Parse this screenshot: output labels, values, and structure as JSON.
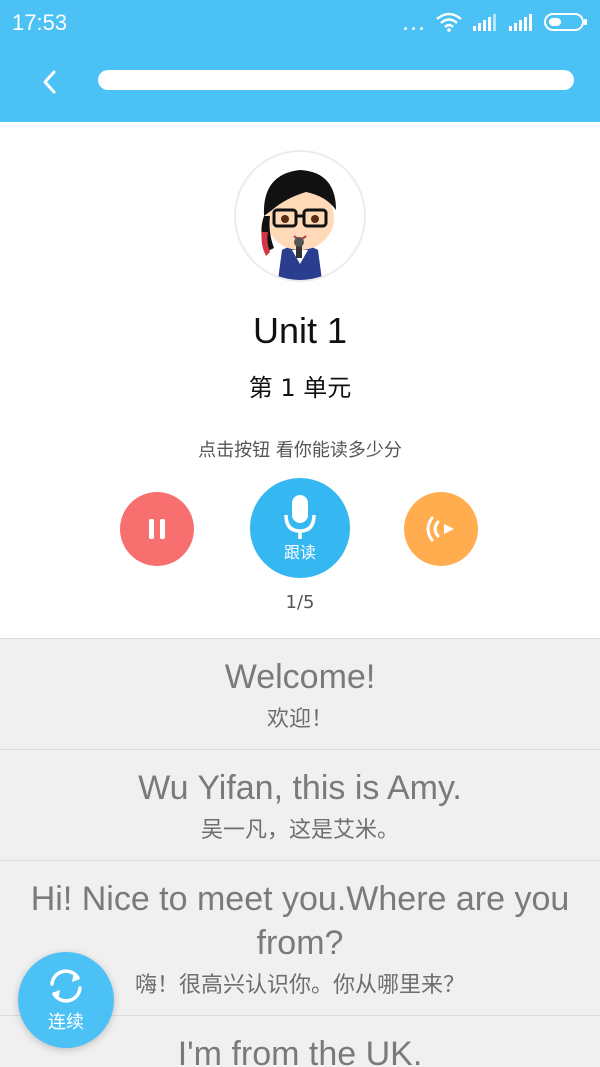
{
  "status_bar": {
    "time": "17:53",
    "dots": "..."
  },
  "header": {
    "back_icon": "chevron-left-icon",
    "progress": 1.0
  },
  "lesson": {
    "title": "Unit 1",
    "subtitle": "第 1 单元",
    "hint": "点击按钮 看你能读多少分",
    "counter": "1/5",
    "record_label": "跟读"
  },
  "sentences": [
    {
      "en": "Welcome!",
      "zh": "欢迎！"
    },
    {
      "en": "Wu Yifan, this is Amy.",
      "zh": "吴一凡，这是艾米。"
    },
    {
      "en": "Hi! Nice to meet you.Where are you from?",
      "zh": "嗨！很高兴认识你。你从哪里来？"
    },
    {
      "en": "I'm from the UK.",
      "zh": ""
    }
  ],
  "fab": {
    "label": "连续",
    "icon": "refresh-icon"
  },
  "colors": {
    "brand": "#4cc1f5",
    "pause": "#f76f6f",
    "record": "#35b7f2",
    "play": "#ffad4f"
  }
}
